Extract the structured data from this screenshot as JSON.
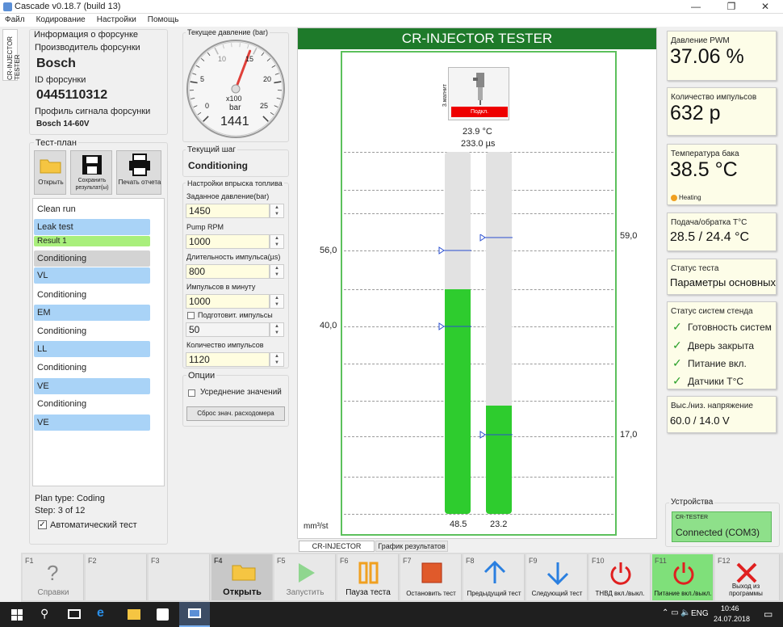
{
  "window": {
    "title": "Cascade v0.18.7 (build 13)"
  },
  "menu": [
    "Файл",
    "Кодирование",
    "Настройки",
    "Помощь"
  ],
  "side_tab": "CR-INJECTOR TESTER",
  "injector_info": {
    "header": "Информация о форсунке",
    "manufacturer_label": "Производитель форсунки",
    "manufacturer": "Bosch",
    "id_label": "ID форсунки",
    "id": "0445110312",
    "profile_label": "Профиль сигнала форсунки",
    "profile": "Bosch 14-60V"
  },
  "test_plan": {
    "header": "Тест-план",
    "open": "Открыть",
    "save": "Сохранить результат(ы)",
    "print": "Печать отчета",
    "items": [
      "Clean run",
      "Leak test",
      "Result 1",
      "Conditioning",
      "VL",
      "Conditioning",
      "EM",
      "Conditioning",
      "LL",
      "Conditioning",
      "VE",
      "Conditioning",
      "VE"
    ],
    "plan_type": "Plan type:  Coding",
    "step": "Step:  3 of 12",
    "auto_test": "Автоматический тест",
    "auto_test_checked": true
  },
  "pressure_gauge": {
    "header": "Текущее давление (bar)",
    "scale": [
      "0",
      "5",
      "10",
      "15",
      "20",
      "25"
    ],
    "unit1": "x100",
    "unit2": "bar",
    "value": "1441"
  },
  "current_step": {
    "header": "Текущий шаг",
    "value": "Conditioning"
  },
  "injection_settings": {
    "header": "Настройки впрыска топлива",
    "fields": [
      {
        "label": "Заданное давление(bar)",
        "value": "1450"
      },
      {
        "label": "Pump RPM",
        "value": "1000"
      },
      {
        "label": "Длительность импульса(µs)",
        "value": "800"
      },
      {
        "label": "Импульсов в минуту",
        "value": "1000"
      },
      {
        "label": "Подготовит. импульсы",
        "value": "50"
      },
      {
        "label": "Количество импульсов",
        "value": "1120"
      }
    ]
  },
  "options": {
    "header": "Опции",
    "averaging": "Усреднение значений",
    "reset_button": "Сброс знач. расходомера"
  },
  "tester": {
    "title": "CR-INJECTOR TESTER",
    "connector_label": "3.магнит",
    "connect_button": "Подкл.",
    "temp": "23.9 °C",
    "pulse": "233.0 µs",
    "unit": "mm³/st",
    "left_marks": [
      "56,0",
      "40,0"
    ],
    "right_marks": [
      "59,0",
      "17,0"
    ],
    "tube1_value": "48.5",
    "tube2_value": "23.2",
    "tube1_fill": 0.62,
    "tube2_fill": 0.3
  },
  "bottom_tabs": [
    "CR-INJECTOR TESTER",
    "График результатов"
  ],
  "right_panel": {
    "pwm": {
      "label": "Давление PWM",
      "value": "37.06 %"
    },
    "pulses": {
      "label": "Количество импульсов",
      "value": "632 p"
    },
    "tank": {
      "label": "Температура бака",
      "value": "38.5 °C",
      "status": "Heating"
    },
    "flow": {
      "label": "Подача/обратка T°C",
      "value": "28.5 / 24.4 °C"
    },
    "test_status": {
      "label": "Статус теста",
      "value": "Параметры основных"
    },
    "systems": {
      "label": "Статус систем стенда",
      "items": [
        "Готовность систем",
        "Дверь закрыта",
        "Питание вкл.",
        "Датчики T°C"
      ]
    },
    "voltage": {
      "label": "Выс./низ. напряжение",
      "value": "60.0 / 14.0 V"
    },
    "devices": {
      "label": "Устройства",
      "device": "CR-TESTER",
      "status": "Connected (COM3)"
    }
  },
  "fkeys": [
    {
      "key": "F1",
      "label": "Справки"
    },
    {
      "key": "F2",
      "label": ""
    },
    {
      "key": "F3",
      "label": ""
    },
    {
      "key": "F4",
      "label": "Открыть"
    },
    {
      "key": "F5",
      "label": "Запустить"
    },
    {
      "key": "F6",
      "label": "Пауза теста"
    },
    {
      "key": "F7",
      "label": "Остановить тест"
    },
    {
      "key": "F8",
      "label": "Предыдущий тест"
    },
    {
      "key": "F9",
      "label": "Следующий тест"
    },
    {
      "key": "F10",
      "label": "ТНВД вкл./выкл."
    },
    {
      "key": "F11",
      "label": "Питание вкл./выкл."
    },
    {
      "key": "F12",
      "label": "Выход из программы"
    }
  ],
  "colors": {
    "tester_green": "#4caf50",
    "fill_green": "#2ecc2e",
    "plan_blue": "#a9d3f7",
    "result_green": "#a9ef7c",
    "stop": "#e05a2b",
    "arrow": "#2a7fe0",
    "power_red": "#e02020"
  },
  "taskbar": {
    "lang": "ENG",
    "time": "10:46",
    "date": "24.07.2018"
  }
}
